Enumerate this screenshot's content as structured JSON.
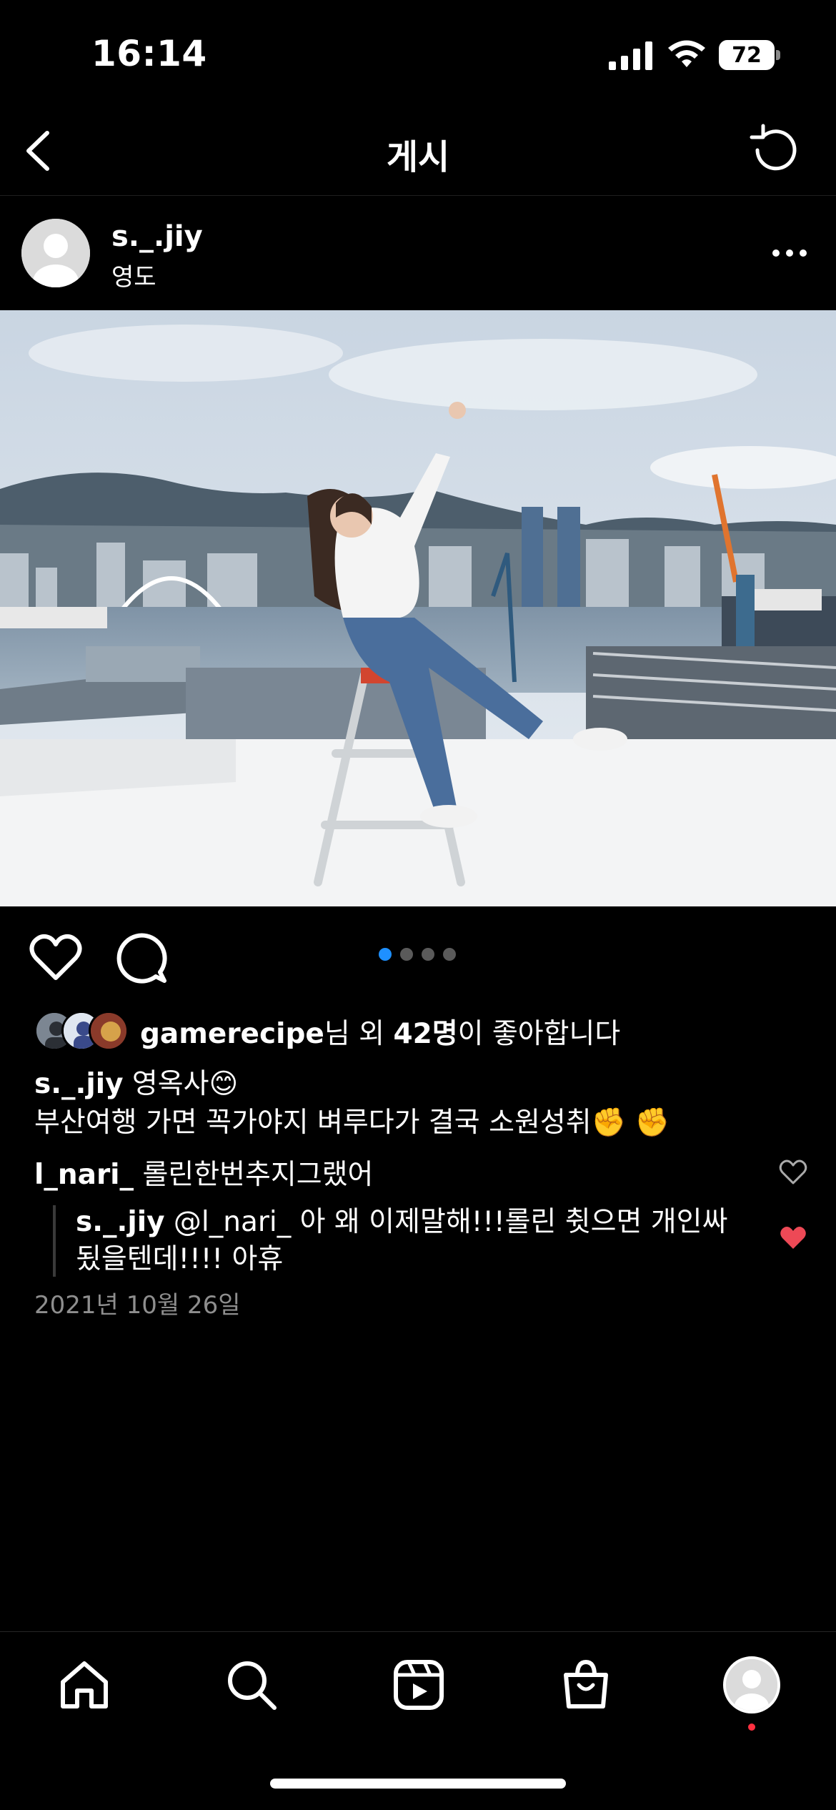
{
  "status_bar": {
    "time": "16:14",
    "battery": "72"
  },
  "nav": {
    "title": "게시"
  },
  "post": {
    "username": "s._.jiy",
    "location": "영도",
    "image_count": 4,
    "active_image_index": 0
  },
  "likes": {
    "user": "gamerecipe",
    "text_1": "님 외 ",
    "count": "42명",
    "text_2": "이 좋아합니다"
  },
  "caption": {
    "username": "s._.jiy",
    "line1": " 영옥사😊",
    "line2": "부산여행 가면 꼭가야지 벼루다가 결국 소원성취✊ ✊"
  },
  "comments": [
    {
      "username": "l_nari_",
      "text": " 롤린한번추지그랬어",
      "liked": false
    }
  ],
  "replies": [
    {
      "username": "s._.jiy",
      "text": " @l_nari_ 아 왜 이제말해!!!롤린 췻으면 개인싸 됬을텐데!!!! 아휴",
      "liked": true
    }
  ],
  "date": "2021년 10월 26일",
  "colors": {
    "accent": "#1e90ff",
    "like_red": "#ed4956",
    "notification": "#ff3040"
  }
}
